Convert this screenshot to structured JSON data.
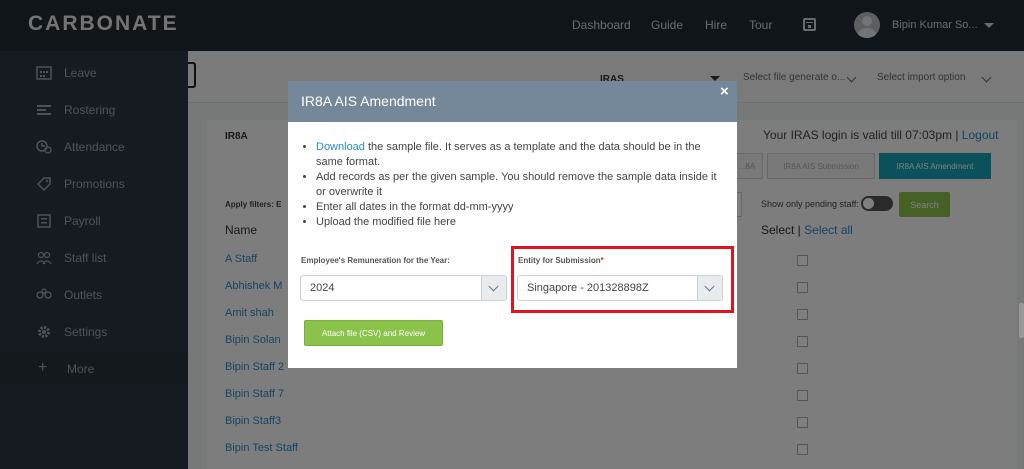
{
  "app": {
    "logo": "CARBONATE"
  },
  "topnav": {
    "items": [
      "Dashboard",
      "Guide",
      "Hire",
      "Tour"
    ],
    "calendar_icon": "calendar-icon",
    "user_name": "Bipin Kumar So..."
  },
  "sidebar": {
    "items": [
      {
        "label": "Leave",
        "icon": "calendar-grid-icon"
      },
      {
        "label": "Rostering",
        "icon": "rostering-icon"
      },
      {
        "label": "Attendance",
        "icon": "attendance-icon"
      },
      {
        "label": "Promotions",
        "icon": "promotions-icon"
      },
      {
        "label": "Payroll",
        "icon": "payroll-icon"
      },
      {
        "label": "Staff list",
        "icon": "staff-list-icon"
      },
      {
        "label": "Outlets",
        "icon": "outlets-icon"
      },
      {
        "label": "Settings",
        "icon": "gear-icon"
      }
    ],
    "more": {
      "symbol": "+",
      "label": "More"
    }
  },
  "main": {
    "iras_select": "IRAS",
    "file_generate_select": "Select file generate o...",
    "import_option_select": "Select import option",
    "tab": "IR8A",
    "login_valid_text": "Your IRAS login is valid till 07:03pm |",
    "logout": "Logout",
    "buttons": {
      "b1": "...8A",
      "b2": "IR8A AIS Submission",
      "b3": "IR8A AIS Amendment"
    },
    "filters_label": "Apply filters: E",
    "pending_label": "Show only pending staff:",
    "search": "Search",
    "name_header": "Name",
    "select_header": "Select |",
    "select_all": "Select all",
    "staff": [
      "A Staff",
      "Abhishek M",
      "Amit shah",
      "Bipin Solan",
      "Bipin Staff 2",
      "Bipin Staff 7",
      "Bipin Staff3",
      "Bipin Test Staff"
    ]
  },
  "modal": {
    "title": "IR8A AIS Amendment",
    "close": "×",
    "instructions": {
      "download_link": "Download",
      "line1_rest": " the sample file. It serves as a template and the data should be in the same format.",
      "line2": "Add records as per the given sample. You should remove the sample data inside it or overwrite it",
      "line3": "Enter all dates in the format dd-mm-yyyy",
      "line4": "Upload the modified file here"
    },
    "year_label": "Employee's Remuneration for the Year:",
    "year_value": "2024",
    "entity_label": "Entity for Submission",
    "required_mark": "*",
    "entity_value": "Singapore - 201328898Z",
    "attach_button": "Attach file (CSV) and Review",
    "highlight_color": "#e0141e"
  }
}
